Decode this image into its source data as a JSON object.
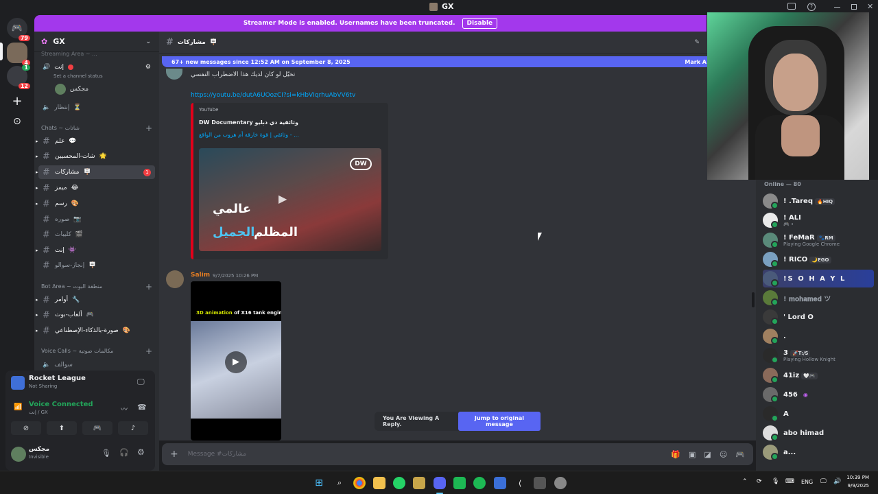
{
  "window": {
    "title": "GX"
  },
  "banner": {
    "text": "Streamer Mode is enabled. Usernames have been truncated.",
    "disable_label": "Disable"
  },
  "rail": {
    "badge_top": "79",
    "badge_1": "4",
    "badge_2": "1",
    "badge_3": "12"
  },
  "guild": {
    "name": "GX"
  },
  "sidebar": {
    "streaming_cat": "Streaming Area ~ ...",
    "voice_top": {
      "name": "إنت",
      "status": "Set a channel status",
      "user": "مجكس"
    },
    "waiting": "إنتظار",
    "chats_cat": "Chats ~ شاتات",
    "chats": [
      {
        "name": "علم",
        "emoji": "💬"
      },
      {
        "name": "شات-المحسيين",
        "emoji": "🌟"
      },
      {
        "name": "مشاركات",
        "emoji": "🪧",
        "count": "1"
      },
      {
        "name": "ميمز",
        "emoji": "😂"
      },
      {
        "name": "رسم",
        "emoji": "🎨"
      },
      {
        "name": "صوره",
        "emoji": "📷"
      },
      {
        "name": "كليبات",
        "emoji": "🎬"
      },
      {
        "name": "إنت",
        "emoji": "👾"
      },
      {
        "name": "إنجاز-سوالو",
        "emoji": "🪧"
      }
    ],
    "bot_cat": "Bot Area ~ منطقة البوت",
    "bots": [
      {
        "name": "أوامر",
        "emoji": "🔧"
      },
      {
        "name": "ألعاب-بوت",
        "emoji": "🎮"
      },
      {
        "name": "صورة-بالذكاء-الإصطناعي",
        "emoji": "🎨"
      }
    ],
    "voice_cat": "Voice Calls ~ مكالمات صوتية",
    "voice_ch": "سوالف"
  },
  "panel": {
    "activity_title": "Rocket League",
    "activity_sub": "Not Sharing",
    "voice_connected": "Voice Connected",
    "voice_where": "إنت / GX",
    "user_name": "مجكس",
    "user_status": "Invisible"
  },
  "header": {
    "channel": "مشاركات"
  },
  "chat": {
    "new_messages": "67+ new messages since 12:52 AM on September 8, 2025",
    "mark_label": "Mark A",
    "msg1_text": "تخيّل لو كان لديك هذا الاضطراب النفسي",
    "msg1_link": "https://youtu.be/dutA6UOozCI?si=kHbVIqrhuAbVV6tv",
    "embed_provider": "YouTube",
    "embed_author": "DW Documentary وثائقية دي دبليو",
    "embed_title": "وثائقي | قوة خارقة أم هروب من الواقع - ...",
    "thumb_text_1": "عالمي",
    "thumb_text_2": "المظلم",
    "thumb_text_3": "الجميل",
    "thumb_logo": "DW",
    "msg2_author": "Salim",
    "msg2_time": "9/7/2025 10:26 PM",
    "video_caption_1": "3D animation",
    "video_caption_2": " of X16 tank engine"
  },
  "reply": {
    "text": "You Are Viewing A Reply.",
    "button": "Jump to original message"
  },
  "composer": {
    "placeholder": "Message #مشاركات"
  },
  "members": {
    "heading": "Online — 80",
    "list": [
      {
        "name": "! .Tareq",
        "tag": "🔥HIQ",
        "sub": ""
      },
      {
        "name": "! ALI",
        "tag": "",
        "sub": "🎮 •"
      },
      {
        "name": "! FeMaR",
        "tag": "🐾RM",
        "sub": "Playing Google Chrome"
      },
      {
        "name": "! RICO",
        "tag": "🌙EGO",
        "sub": ""
      },
      {
        "name": "!S O H A Y L",
        "tag": "",
        "sub": ""
      },
      {
        "name": "! 𝐦𝐨𝐡𝐚𝐦𝐞𝐝 ツ",
        "tag": "",
        "sub": ""
      },
      {
        "name": "' Lord O",
        "tag": "",
        "sub": ""
      },
      {
        "name": ".",
        "tag": "",
        "sub": ""
      },
      {
        "name": "3",
        "tag": "🚀T:/S",
        "sub": "Playing Hollow Knight"
      },
      {
        "name": "41iz",
        "tag": "🤍🎮",
        "sub": ""
      },
      {
        "name": "456",
        "tag": "",
        "sub": ""
      },
      {
        "name": "A",
        "tag": "",
        "sub": ""
      },
      {
        "name": "abo himad",
        "tag": "",
        "sub": ""
      },
      {
        "name": "a...",
        "tag": "",
        "sub": ""
      }
    ]
  },
  "taskbar": {
    "lang": "ENG",
    "time": "10:39 PM",
    "date": "9/9/2025"
  },
  "colors": {
    "accent": "#5865f2",
    "streamer": "#a338ec",
    "online": "#23a55a"
  }
}
